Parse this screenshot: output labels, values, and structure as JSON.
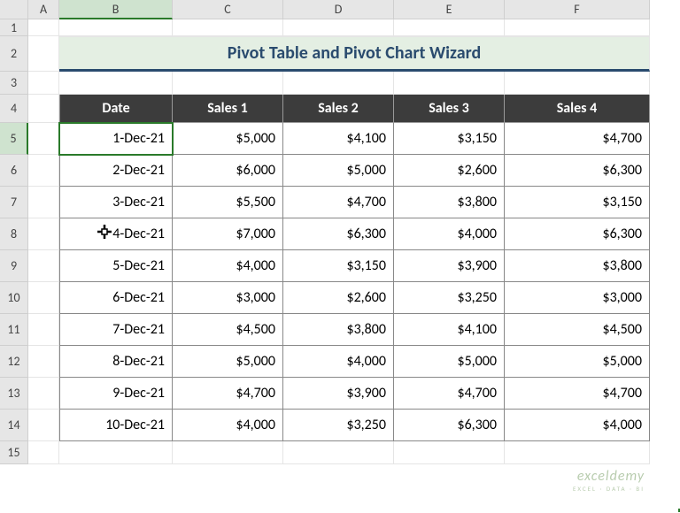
{
  "columns": [
    "A",
    "B",
    "C",
    "D",
    "E",
    "F"
  ],
  "rows": [
    "1",
    "2",
    "3",
    "4",
    "5",
    "6",
    "7",
    "8",
    "9",
    "10",
    "11",
    "12",
    "13",
    "14",
    "15"
  ],
  "selected_col": "B",
  "selected_row": "5",
  "title": "Pivot Table and Pivot Chart Wizard",
  "headers": [
    "Date",
    "Sales 1",
    "Sales 2",
    "Sales 3",
    "Sales 4"
  ],
  "data_rows": [
    {
      "date": "1-Dec-21",
      "s1": "$5,000",
      "s2": "$4,100",
      "s3": "$3,150",
      "s4": "$4,700"
    },
    {
      "date": "2-Dec-21",
      "s1": "$6,000",
      "s2": "$5,000",
      "s3": "$2,600",
      "s4": "$6,300"
    },
    {
      "date": "3-Dec-21",
      "s1": "$5,500",
      "s2": "$4,700",
      "s3": "$3,800",
      "s4": "$3,150"
    },
    {
      "date": "4-Dec-21",
      "s1": "$7,000",
      "s2": "$6,300",
      "s3": "$4,000",
      "s4": "$6,300"
    },
    {
      "date": "5-Dec-21",
      "s1": "$4,000",
      "s2": "$3,150",
      "s3": "$3,900",
      "s4": "$3,800"
    },
    {
      "date": "6-Dec-21",
      "s1": "$3,000",
      "s2": "$2,600",
      "s3": "$3,250",
      "s4": "$3,000"
    },
    {
      "date": "7-Dec-21",
      "s1": "$4,500",
      "s2": "$3,800",
      "s3": "$4,100",
      "s4": "$4,500"
    },
    {
      "date": "8-Dec-21",
      "s1": "$5,000",
      "s2": "$4,000",
      "s3": "$5,000",
      "s4": "$5,000"
    },
    {
      "date": "9-Dec-21",
      "s1": "$4,700",
      "s2": "$3,900",
      "s3": "$4,700",
      "s4": "$4,700"
    },
    {
      "date": "10-Dec-21",
      "s1": "$4,000",
      "s2": "$3,250",
      "s3": "$6,300",
      "s4": "$4,000"
    }
  ],
  "watermark": {
    "main": "exceldemy",
    "sub": "EXCEL · DATA · BI"
  },
  "chart_data": {
    "type": "table",
    "title": "Pivot Table and Pivot Chart Wizard",
    "columns": [
      "Date",
      "Sales 1",
      "Sales 2",
      "Sales 3",
      "Sales 4"
    ],
    "rows": [
      [
        "1-Dec-21",
        5000,
        4100,
        3150,
        4700
      ],
      [
        "2-Dec-21",
        6000,
        5000,
        2600,
        6300
      ],
      [
        "3-Dec-21",
        5500,
        4700,
        3800,
        3150
      ],
      [
        "4-Dec-21",
        7000,
        6300,
        4000,
        6300
      ],
      [
        "5-Dec-21",
        4000,
        3150,
        3900,
        3800
      ],
      [
        "6-Dec-21",
        3000,
        2600,
        3250,
        3000
      ],
      [
        "7-Dec-21",
        4500,
        3800,
        4100,
        4500
      ],
      [
        "8-Dec-21",
        5000,
        4000,
        5000,
        5000
      ],
      [
        "9-Dec-21",
        4700,
        3900,
        4700,
        4700
      ],
      [
        "10-Dec-21",
        4000,
        3250,
        6300,
        4000
      ]
    ]
  }
}
